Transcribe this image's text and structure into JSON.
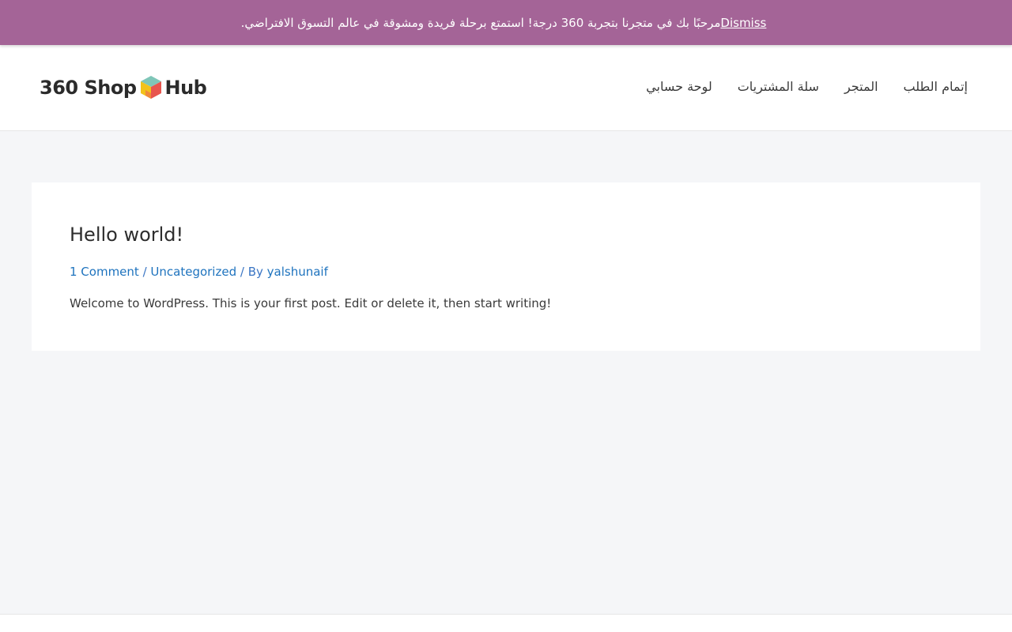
{
  "notice": {
    "message": "مرحبًا بك في متجرنا بتجربة 360 درجة! استمتع برحلة فريدة ومشوقة في عالم التسوق الافتراضي.",
    "dismiss_label": "Dismiss",
    "background": "#a46497"
  },
  "header": {
    "logo": {
      "left_text": "360 Shop",
      "right_text": "Hub"
    },
    "nav": [
      {
        "label": "لوحة حسابي"
      },
      {
        "label": "سلة المشتريات"
      },
      {
        "label": "المتجر"
      },
      {
        "label": "إتمام الطلب"
      }
    ]
  },
  "post": {
    "title": "Hello world!",
    "meta": {
      "comments": "1 Comment",
      "separator": " / ",
      "category": "Uncategorized",
      "by_prefix": " / By ",
      "author": "yalshunaif"
    },
    "excerpt": "Welcome to WordPress. This is your first post. Edit or delete it, then start writing!"
  },
  "colors": {
    "link": "#1e73be",
    "page_bg": "#f5f6f8"
  }
}
